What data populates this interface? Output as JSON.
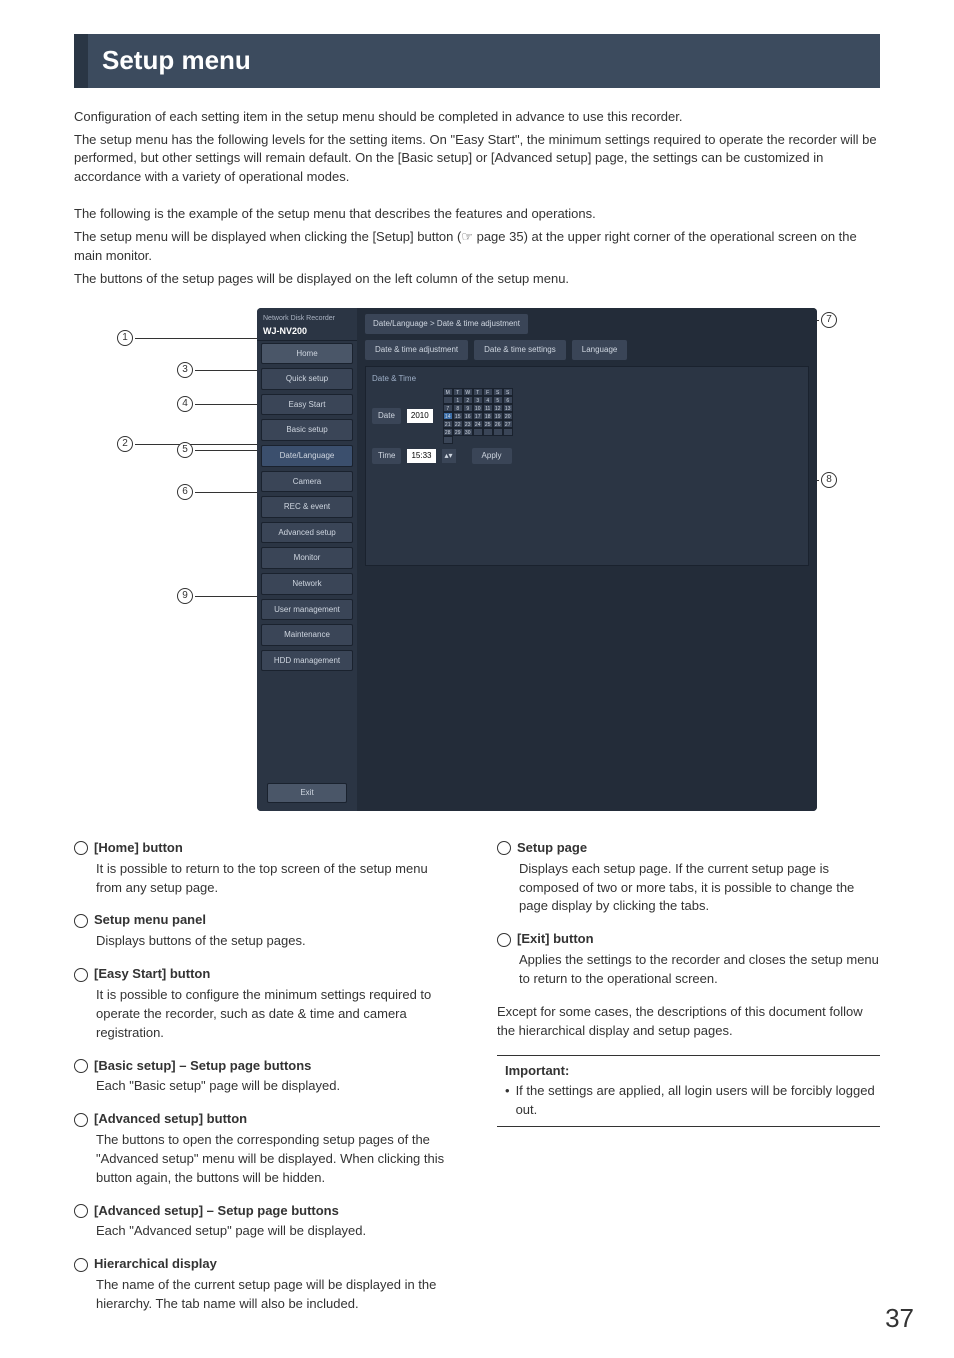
{
  "title": "Setup menu",
  "intro": [
    "Configuration of each setting item in the setup menu should be completed in advance to use this recorder.",
    "The setup menu has the following levels for the setting items. On \"Easy Start\", the minimum settings required to operate the recorder will be performed, but other settings will remain default. On the [Basic setup] or [Advanced setup] page, the settings can be customized in accordance with a variety of operational modes."
  ],
  "intro2": [
    "The following is the example of the setup menu that describes the features and operations.",
    "The setup menu will be displayed when clicking the [Setup] button (☞ page 35) at the upper right corner of the operational screen on the main monitor.",
    "The buttons of the setup pages will be displayed on the left column of the setup menu."
  ],
  "screenshot": {
    "brand_line1": "Network Disk Recorder",
    "brand_model": "WJ-NV200",
    "nav": {
      "home": "Home",
      "quick": "Quick setup",
      "easy": "Easy Start",
      "basic": "Basic setup",
      "datelang": "Date/Language",
      "camera": "Camera",
      "recevent": "REC & event",
      "advanced": "Advanced setup",
      "monitor": "Monitor",
      "network": "Network",
      "usermgmt": "User management",
      "maint": "Maintenance",
      "hdd": "HDD management",
      "exit": "Exit"
    },
    "breadcrumb": "Date/Language > Date & time adjustment",
    "tabs": [
      "Date & time adjustment",
      "Date & time settings",
      "Language"
    ],
    "panel_title": "Date & Time",
    "date_label": "Date",
    "date_year": "2010",
    "time_label": "Time",
    "time_value": "15:33",
    "apply": "Apply",
    "cal_days": [
      "MON",
      "TUE",
      "WED",
      "THU",
      "FRI",
      "SAT",
      "SUN"
    ],
    "cal_numbers": [
      "",
      "1",
      "2",
      "3",
      "4",
      "5",
      "6",
      "7",
      "8",
      "9",
      "10",
      "11",
      "12",
      "13",
      "14",
      "15",
      "16",
      "17",
      "18",
      "19",
      "20",
      "21",
      "22",
      "23",
      "24",
      "25",
      "26",
      "27",
      "28",
      "29",
      "30",
      "",
      "",
      "",
      "",
      ""
    ]
  },
  "items_left": [
    {
      "n": "①",
      "title": "[Home] button",
      "body": "It is possible to return to the top screen of the setup menu from any setup page."
    },
    {
      "n": "②",
      "title": "Setup menu panel",
      "body": "Displays buttons of the setup pages."
    },
    {
      "n": "③",
      "title": "[Easy Start] button",
      "body": "It is possible to configure the minimum settings required to operate the recorder, such as date & time and camera registration."
    },
    {
      "n": "④",
      "title": "[Basic setup] – Setup page buttons",
      "body": "Each \"Basic setup\" page will be displayed."
    },
    {
      "n": "⑤",
      "title": "[Advanced setup] button",
      "body": "The buttons to open the corresponding setup pages of the \"Advanced setup\" menu will be displayed. When clicking this button again, the buttons will be hidden."
    },
    {
      "n": "⑥",
      "title": "[Advanced setup] – Setup page buttons",
      "body": "Each \"Advanced setup\" page will be displayed."
    },
    {
      "n": "⑦",
      "title": "Hierarchical display",
      "body": "The name of the current setup page will be displayed in the hierarchy. The tab name will also be included."
    }
  ],
  "items_right": [
    {
      "n": "⑧",
      "title": "Setup page",
      "body": "Displays each setup page. If the current setup page is composed of two or more tabs, it is possible to change the page display by clicking the tabs."
    },
    {
      "n": "⑨",
      "title": "[Exit] button",
      "body": "Applies the settings to the recorder and closes the setup menu to return to the operational screen."
    }
  ],
  "right_extra": "Except for some cases, the descriptions of this document follow the hierarchical display and setup pages.",
  "important_head": "Important:",
  "important_bullet": "If the settings are applied, all login users will be forcibly logged out.",
  "page_number": "37"
}
